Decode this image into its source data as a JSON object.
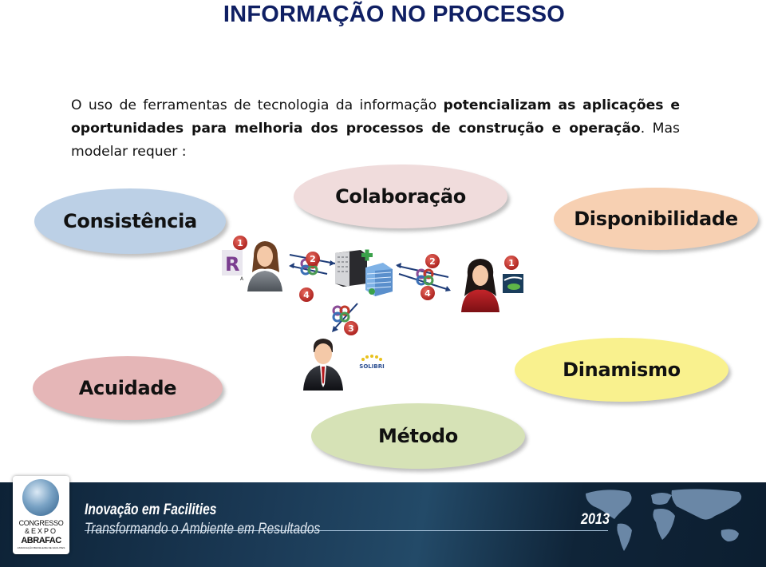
{
  "slide": {
    "title": "INFORMAÇÃO NO PROCESSO",
    "paragraph": {
      "line1_regular": "O uso de ferramentas de tecnologia da informação ",
      "line1_bold": "potencializam as aplicações e oportunidades para melhoria dos processos de construção e operação",
      "tail": ". Mas modelar requer :"
    },
    "requirements": [
      {
        "label": "Consistência",
        "color": "#bcd0e6"
      },
      {
        "label": "Colaboração",
        "color": "#f0dcdc"
      },
      {
        "label": "Disponibilidade",
        "color": "#f7d0b2"
      },
      {
        "label": "Acuidade",
        "color": "#e5b6b7"
      },
      {
        "label": "Dinamismo",
        "color": "#f9f18e"
      },
      {
        "label": "Método",
        "color": "#d6e2b6"
      }
    ],
    "diagram": {
      "step_badges": [
        "1",
        "2",
        "4",
        "2",
        "4",
        "1",
        "3"
      ],
      "icons": [
        "revit-app-icon",
        "female-user-icon",
        "server-icon",
        "building-icon",
        "exchange-arrows-icon",
        "female-user-red-icon",
        "navisworks-app-icon",
        "male-user-icon",
        "solibri-logo"
      ],
      "solibri_text": "SOLIBRI"
    }
  },
  "footer": {
    "logo": {
      "line1": "CONGRESSO",
      "line2": "&EXPO",
      "line3": "ABRAFAC",
      "line4": "ASSOCIAÇÃO BRASILEIRA DE FACILITIES"
    },
    "tagline": "Inovação em Facilities",
    "subtitle": "Transformando o Ambiente em Resultados",
    "year": "2013"
  },
  "colors": {
    "title": "#0f1f63",
    "footer_bg": "#0d2236",
    "badge": "#c9302c"
  }
}
